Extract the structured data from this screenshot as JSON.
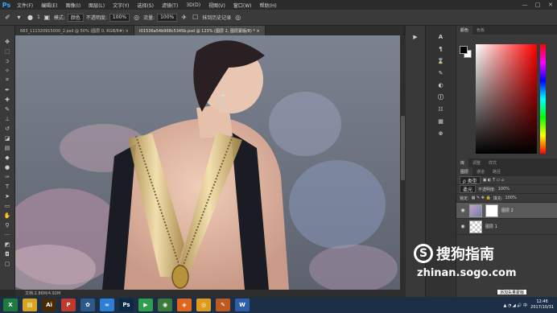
{
  "app": {
    "logo": "Ps"
  },
  "menu": [
    "文件(F)",
    "编辑(E)",
    "图像(I)",
    "图层(L)",
    "文字(Y)",
    "选择(S)",
    "滤镜(T)",
    "3D(D)",
    "视图(V)",
    "窗口(W)",
    "帮助(H)"
  ],
  "window_controls": [
    "—",
    "□",
    "✕"
  ],
  "options": {
    "brush_size": "1",
    "mode_label": "模式:",
    "mode_value": "颜色",
    "opacity_label": "不透明度:",
    "opacity_value": "100%",
    "flow_label": "流量:",
    "flow_value": "100%",
    "history_label": "抹到历史记录"
  },
  "tabs": [
    {
      "label": "683_111320915000_2.psd @ 50% (图层 0, RGB/8#) ×",
      "active": false
    },
    {
      "label": "t01536a54b968c5345b.psd @ 123% (图层 2, 图层蒙版/8) * ×",
      "active": true
    }
  ],
  "status": {
    "text": "文档:2.86M/4.92M"
  },
  "panels": {
    "color_tabs": [
      "颜色",
      "色板"
    ],
    "lib_tabs": [
      "库",
      "调整",
      "样式"
    ],
    "layer_tabs": [
      "图层",
      "通道",
      "路径"
    ],
    "kind_label": "ρ 类型",
    "blend_mode": "柔光",
    "opacity_label": "不透明度:",
    "opacity_value": "100%",
    "lock_label": "锁定:",
    "fill_label": "填充:",
    "fill_value": "100%",
    "layers": [
      {
        "name": "图层 2",
        "selected": true
      },
      {
        "name": "图层 1",
        "selected": false
      }
    ]
  },
  "tooltip": "添加矢量蒙版",
  "watermark": {
    "logo": "S",
    "title": "搜狗指南",
    "url": "zhinan.sogo.com"
  },
  "taskbar": {
    "apps": [
      {
        "label": "X",
        "color": "#1f7a3f"
      },
      {
        "label": "▤",
        "color": "#d9a520"
      },
      {
        "label": "Ai",
        "color": "#4a2a05"
      },
      {
        "label": "P",
        "color": "#c0392b"
      },
      {
        "label": "✿",
        "color": "#2b5a8a"
      },
      {
        "label": "∞",
        "color": "#2d7fd6"
      },
      {
        "label": "Ps",
        "color": "#0b2a47"
      },
      {
        "label": "▶",
        "color": "#2e9e4f"
      },
      {
        "label": "◉",
        "color": "#3a7a3a"
      },
      {
        "label": "◈",
        "color": "#e0661c"
      },
      {
        "label": "◎",
        "color": "#e09b1c"
      },
      {
        "label": "✎",
        "color": "#c05a1c"
      },
      {
        "label": "W",
        "color": "#2f5ea8"
      }
    ],
    "time": "12:46",
    "date": "2017/10/31"
  }
}
